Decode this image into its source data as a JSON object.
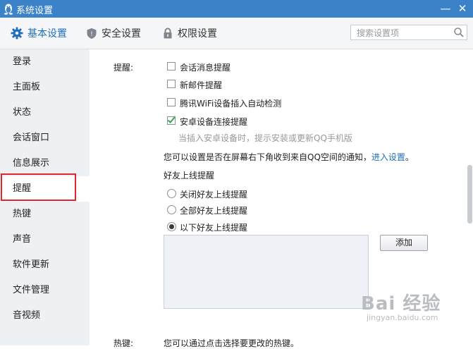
{
  "window": {
    "title": "系统设置",
    "minimize": "—",
    "close": "✕"
  },
  "toolbar": {
    "tabs": [
      {
        "label": "基本设置",
        "icon": "gear-icon"
      },
      {
        "label": "安全设置",
        "icon": "shield-icon"
      },
      {
        "label": "权限设置",
        "icon": "lock-icon"
      }
    ],
    "search_placeholder": "搜索设置项"
  },
  "sidebar": {
    "items": [
      "登录",
      "主面板",
      "状态",
      "会话窗口",
      "信息展示",
      "提醒",
      "热键",
      "声音",
      "软件更新",
      "文件管理",
      "音视频"
    ],
    "selected": "提醒"
  },
  "reminder": {
    "section_label": "提醒:",
    "checkboxes": [
      {
        "label": "会话消息提醒",
        "checked": false
      },
      {
        "label": "新邮件提醒",
        "checked": false
      },
      {
        "label": "腾讯WiFi设备插入自动检测",
        "checked": false
      },
      {
        "label": "安卓设备连接提醒",
        "checked": true
      }
    ],
    "android_hint": "当插入安卓设备时，提示安装或更新QQ手机版",
    "notice_text": "您可以设置是否在屏幕右下角收到来自QQ空间的通知，",
    "notice_link": "进入设置",
    "notice_end": "。",
    "friend_online_title": "好友上线提醒",
    "radios": [
      {
        "label": "关闭好友上线提醒",
        "selected": false
      },
      {
        "label": "全部好友上线提醒",
        "selected": false
      },
      {
        "label": "以下好友上线提醒",
        "selected": true
      }
    ],
    "add_button": "添加"
  },
  "hotkey": {
    "section_label": "热键:",
    "text": "您可以通过点击选择要更改的热键。"
  },
  "watermark": {
    "main": "Bai 经验",
    "sub": "jingyan.baidu.com"
  },
  "colors": {
    "titlebar": "#3c82c8",
    "accent": "#1f6fbd",
    "highlight_box": "#e5252e"
  }
}
